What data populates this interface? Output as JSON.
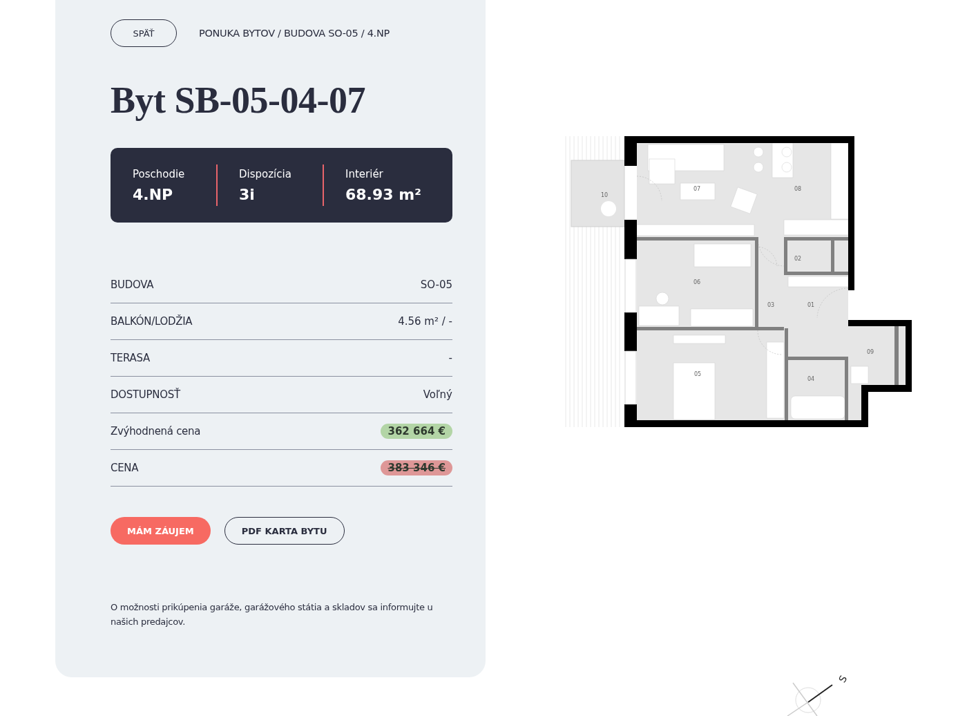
{
  "back_button": "SPÄŤ",
  "breadcrumb": "PONUKA BYTOV / BUDOVA SO-05 / 4.NP",
  "title": "Byt SB-05-04-07",
  "stats": [
    {
      "label": "Poschodie",
      "value": "4.NP"
    },
    {
      "label": "Dispozícia",
      "value": "3i"
    },
    {
      "label": "Interiér",
      "value": "68.93 m²"
    }
  ],
  "details": [
    {
      "kind": "text",
      "label": "BUDOVA",
      "value": "SO-05"
    },
    {
      "kind": "text",
      "label": "BALKÓN/LODŽIA",
      "value": "4.56 m² / -"
    },
    {
      "kind": "text",
      "label": "TERASA",
      "value": "-"
    },
    {
      "kind": "text",
      "label": "DOSTUPNOSŤ",
      "value": "Voľný"
    },
    {
      "kind": "price",
      "label": "Zvýhodnená cena",
      "value": "362 664 €",
      "color": "#b3d5a6",
      "struck": false
    },
    {
      "kind": "price",
      "label": "CENA",
      "value": "383 346 €",
      "color": "#de9797",
      "struck": true
    }
  ],
  "actions": [
    {
      "kind": "primary",
      "label": "MÁM ZÁUJEM"
    },
    {
      "kind": "outline",
      "label": "PDF KARTA BYTU"
    }
  ],
  "note": "O možnosti prikúpenia garáže, garážového státia a skladov sa informujte u našich predajcov.",
  "floor_plan": {
    "rooms": [
      "10",
      "07",
      "08",
      "02",
      "06",
      "03",
      "01",
      "09",
      "05",
      "04"
    ]
  },
  "compass": {
    "label": "S"
  }
}
